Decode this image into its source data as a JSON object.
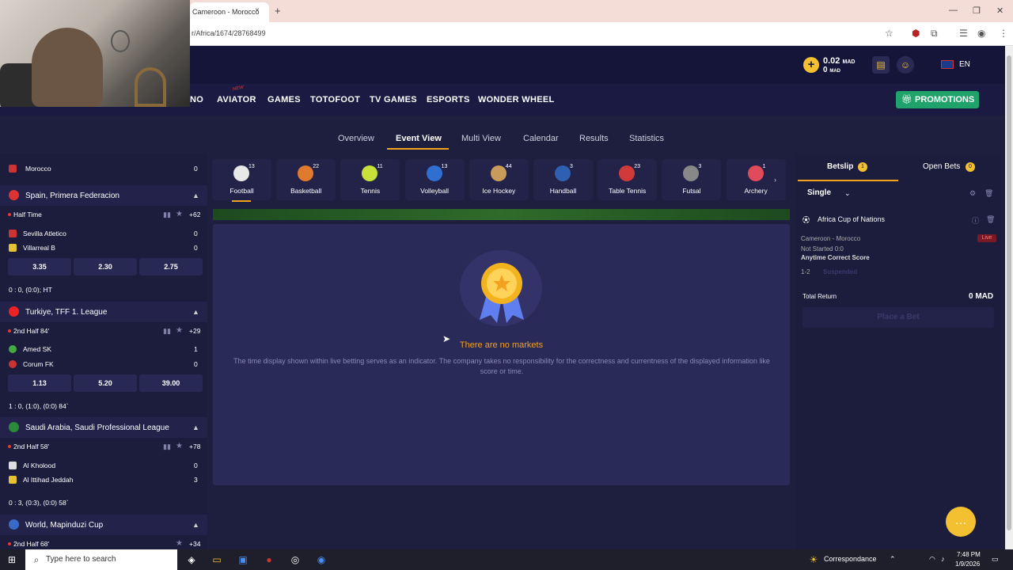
{
  "browser": {
    "tab_title": "Cameroon - Morocco",
    "tab_close": "×",
    "new_tab": "+",
    "url": "r/Africa/1674/28768499",
    "min": "—",
    "max": "❐",
    "close": "✕"
  },
  "header": {
    "balance_main": "0.02",
    "balance_main_currency": "MAD",
    "balance_bonus": "0",
    "balance_bonus_currency": "MAD",
    "language": "EN",
    "promotions": "PROMOTIONS"
  },
  "nav": {
    "items": [
      "NO",
      "AVIATOR",
      "GAMES",
      "TOTOFOOT",
      "TV GAMES",
      "ESPORTS",
      "WONDER WHEEL"
    ],
    "aviator_badge": "NEW"
  },
  "subnav": {
    "items": [
      "Overview",
      "Event View",
      "Multi View",
      "Calendar",
      "Results",
      "Statistics"
    ],
    "active": "Event View"
  },
  "sports": [
    {
      "name": "Football",
      "count": "13",
      "color": "#e8e8e8"
    },
    {
      "name": "Basketball",
      "count": "22",
      "color": "#e07a2f"
    },
    {
      "name": "Tennis",
      "count": "11",
      "color": "#c8e03a"
    },
    {
      "name": "Volleyball",
      "count": "13",
      "color": "#2f6fd0"
    },
    {
      "name": "Ice Hockey",
      "count": "44",
      "color": "#c89b5a"
    },
    {
      "name": "Handball",
      "count": "3",
      "color": "#2f5fb0"
    },
    {
      "name": "Table Tennis",
      "count": "23",
      "color": "#d03a3a"
    },
    {
      "name": "Futsal",
      "count": "3",
      "color": "#888"
    },
    {
      "name": "Archery",
      "count": "1",
      "color": "#e04a5a"
    }
  ],
  "left": {
    "partial_team": "Morocco",
    "partial_score": "0",
    "leagues": [
      {
        "name": "Spain, Primera Federacion",
        "period": "Half Time",
        "plus": "+62",
        "team1": "Sevilla Atletico",
        "score1": "0",
        "team2": "Villarreal B",
        "score2": "0",
        "odds": [
          "3.35",
          "2.30",
          "2.75"
        ],
        "result": "0 : 0, (0:0); HT"
      },
      {
        "name": "Turkiye, TFF 1. League",
        "period": "2nd Half 84'",
        "plus": "+29",
        "team1": "Amed SK",
        "score1": "1",
        "team2": "Corum FK",
        "score2": "0",
        "odds": [
          "1.13",
          "5.20",
          "39.00"
        ],
        "result": "1 : 0, (1:0), (0:0) 84`"
      },
      {
        "name": "Saudi Arabia, Saudi Professional League",
        "period": "2nd Half 58'",
        "plus": "+78",
        "team1": "Al Kholood",
        "score1": "0",
        "team2": "Al Ittihad Jeddah",
        "score2": "3",
        "result": "0 : 3, (0:3), (0:0) 58`"
      },
      {
        "name": "World, Mapinduzi Cup",
        "period": "2nd Half 68'",
        "plus": "+34"
      }
    ]
  },
  "main": {
    "no_markets": "There are no markets",
    "disclaimer": "The time display shown within live betting serves as an indicator. The company takes no responsibility for the correctness and currentness of the displayed information like score or time."
  },
  "betslip": {
    "tab_betslip": "Betslip",
    "tab_betslip_count": "1",
    "tab_open": "Open Bets",
    "tab_open_count": "0",
    "type": "Single",
    "competition": "Africa Cup of Nations",
    "match": "Cameroon - Morocco",
    "live": "Live",
    "status": "Not Started 0:0",
    "market": "Anytime Correct Score",
    "selection": "1-2",
    "suspended": "Suspended",
    "total_return_label": "Total Return",
    "total_return": "0 MAD",
    "place_bet": "Place a Bet"
  },
  "taskbar": {
    "search": "Type here to search",
    "weather": "Correspondance",
    "time": "7:48 PM",
    "date": "1/9/2026"
  }
}
